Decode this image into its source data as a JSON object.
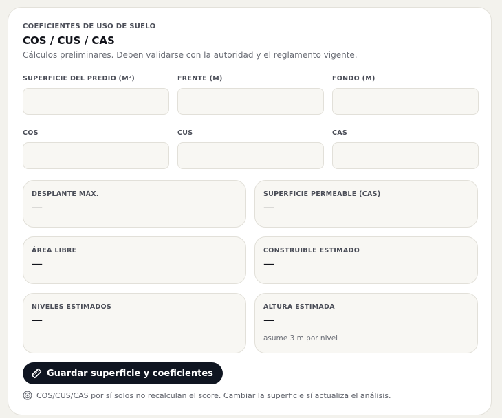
{
  "section": {
    "eyebrow": "COEFICIENTES DE USO DE SUELO",
    "title": "COS / CUS / CAS",
    "subtitle": "Cálculos preliminares. Deben validarse con la autoridad y el reglamento vigente."
  },
  "fields": {
    "superficie": {
      "label": "SUPERFICIE DEL PREDIO (M²)",
      "value": "",
      "placeholder": ""
    },
    "frente": {
      "label": "FRENTE (M)",
      "value": "",
      "placeholder": ""
    },
    "fondo": {
      "label": "FONDO (M)",
      "value": "",
      "placeholder": ""
    },
    "cos": {
      "label": "COS",
      "value": "",
      "placeholder": ""
    },
    "cus": {
      "label": "CUS",
      "value": "",
      "placeholder": ""
    },
    "cas": {
      "label": "CAS",
      "value": "",
      "placeholder": ""
    }
  },
  "metrics": {
    "desplante": {
      "label": "DESPLANTE MÁX.",
      "value": "—"
    },
    "permeable": {
      "label": "SUPERFICIE PERMEABLE (CAS)",
      "value": "—"
    },
    "area_libre": {
      "label": "ÁREA LIBRE",
      "value": "—"
    },
    "construible": {
      "label": "CONSTRUIBLE ESTIMADO",
      "value": "—"
    },
    "niveles": {
      "label": "NIVELES ESTIMADOS",
      "value": "—"
    },
    "altura": {
      "label": "ALTURA ESTIMADA",
      "value": "—",
      "note": "asume 3 m por nivel"
    }
  },
  "actions": {
    "save_label": "Guardar superficie y coeficientes",
    "save_icon": "ruler-icon"
  },
  "footnote": {
    "icon": "target-icon",
    "text": "COS/CUS/CAS por sí solos no recalculan el score. Cambiar la superficie sí actualiza el análisis."
  },
  "colors": {
    "card_bg": "#ffffff",
    "page_bg": "#f3f2ed",
    "field_bg": "#f8f7f3",
    "border": "#e2e0d9",
    "button_bg": "#0f1521",
    "text_primary": "#11131a",
    "text_muted": "#6a6d75"
  }
}
